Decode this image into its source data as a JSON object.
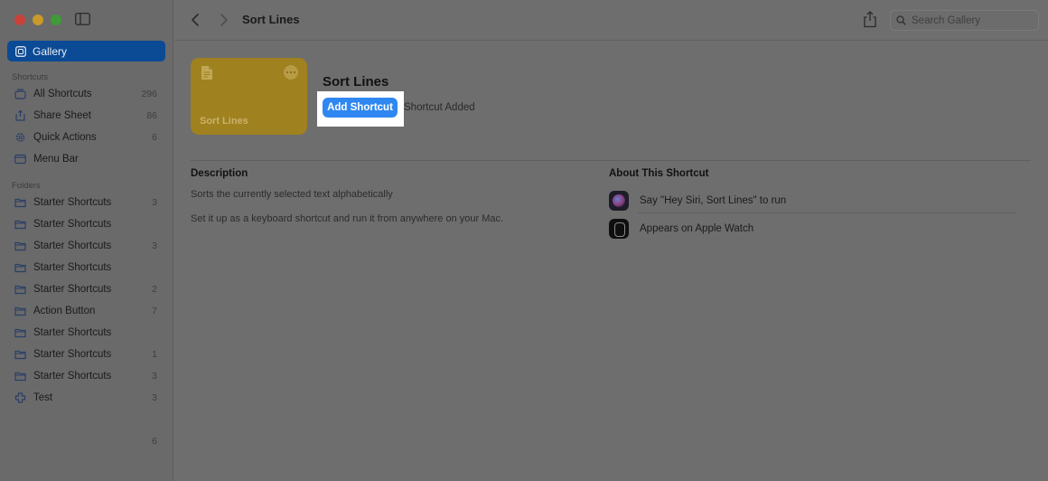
{
  "window": {
    "title": "Sort Lines"
  },
  "sidebar": {
    "gallery_label": "Gallery",
    "shortcuts_header": "Shortcuts",
    "shortcuts": [
      {
        "label": "All Shortcuts",
        "count": "296",
        "icon": "stack-icon"
      },
      {
        "label": "Share Sheet",
        "count": "86",
        "icon": "share-icon"
      },
      {
        "label": "Quick Actions",
        "count": "6",
        "icon": "gear-icon"
      },
      {
        "label": "Menu Bar",
        "count": "",
        "icon": "menubar-icon"
      }
    ],
    "folders_header": "Folders",
    "folders": [
      {
        "label": "Starter Shortcuts",
        "count": "3",
        "icon": "folder-icon"
      },
      {
        "label": "Starter Shortcuts",
        "count": "",
        "icon": "folder-icon"
      },
      {
        "label": "Starter Shortcuts",
        "count": "3",
        "icon": "folder-icon"
      },
      {
        "label": "Starter Shortcuts",
        "count": "",
        "icon": "folder-icon"
      },
      {
        "label": "Starter Shortcuts",
        "count": "2",
        "icon": "folder-icon"
      },
      {
        "label": "Action Button",
        "count": "7",
        "icon": "folder-icon"
      },
      {
        "label": "Starter Shortcuts",
        "count": "",
        "icon": "folder-icon"
      },
      {
        "label": "Starter Shortcuts",
        "count": "1",
        "icon": "folder-icon"
      },
      {
        "label": "Starter Shortcuts",
        "count": "3",
        "icon": "folder-icon"
      },
      {
        "label": "Test",
        "count": "3",
        "icon": "puzzle-icon"
      }
    ],
    "bottom_count": "6"
  },
  "toolbar": {
    "title": "Sort Lines",
    "search_placeholder": "Search Gallery"
  },
  "shortcut": {
    "tile_name": "Sort Lines",
    "title": "Sort Lines",
    "add_button_label": "Add Shortcut",
    "added_status": "Shortcut Added",
    "tile_color": "#9f8120"
  },
  "description": {
    "heading": "Description",
    "line1": "Sorts the currently selected text alphabetically",
    "line2": "Set it up as a keyboard shortcut and run it from anywhere on your Mac."
  },
  "about": {
    "heading": "About This Shortcut",
    "siri_text": "Say \"Hey Siri, Sort Lines\" to run",
    "watch_text": "Appears on Apple Watch"
  },
  "colors": {
    "accent": "#2f87f1",
    "sidebar_selected": "#0b4a94"
  }
}
